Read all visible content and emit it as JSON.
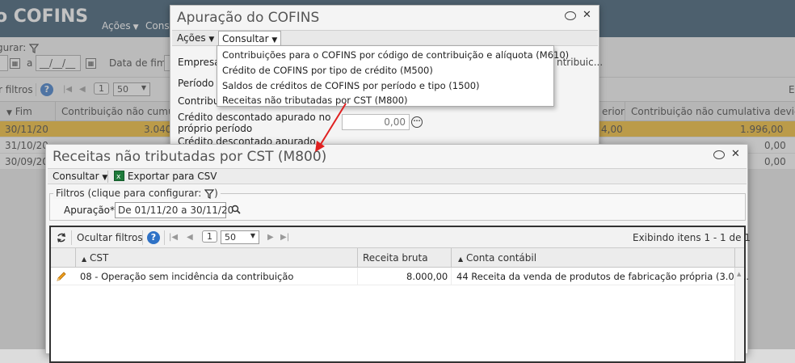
{
  "background": {
    "app_title": "o COFINS",
    "menu": {
      "acoes": "Ações",
      "cons": "Cons"
    },
    "filter_label": "gurar:",
    "date_placeholder": "__/__/__",
    "date_sep": "a",
    "date_end_label": "Data de fim",
    "toolbar_filters": "r filtros",
    "page_num": "1",
    "page_size": "50",
    "right_edge_text": "E",
    "grid_headers": {
      "fim": "Fim",
      "contrib_nao_cumul": "Contribuição não cumulativ",
      "erior": "erior",
      "contrib_devida": "Contribuição não cumulativa devida"
    },
    "rows": [
      {
        "fim": "30/11/20",
        "valor": "3.040",
        "anterior": "4,00",
        "devida": "1.996,00"
      },
      {
        "fim": "31/10/20",
        "valor": "",
        "anterior": "",
        "devida": "0,00"
      },
      {
        "fim": "30/09/20",
        "valor": "",
        "anterior": "",
        "devida": "0,00"
      }
    ]
  },
  "dialog1": {
    "title": "Apuração do COFINS",
    "menu": {
      "acoes": "Ações",
      "consultar": "Consultar"
    },
    "dropdown": [
      "Contribuições para o COFINS por código de contribuição e alíquota (M610)",
      "Crédito de COFINS por tipo de crédito (M500)",
      "Saldos de créditos de COFINS por período e tipo (1500)",
      "Receitas não tributadas por CST (M800)"
    ],
    "labels": {
      "empresa": "Empresa",
      "periodo": "Período d",
      "contribui": "Contribui",
      "credito_proprio_1": "Crédito descontado apurado no",
      "credito_proprio_2": "próprio período",
      "credito_apurado": "Crédito descontado apurado",
      "tribuic": "ntribuic..."
    },
    "credito_value": "0,00"
  },
  "dialog2": {
    "title": "Receitas não tributadas por CST (M800)",
    "menu": {
      "consultar": "Consultar",
      "exportar": "Exportar para CSV"
    },
    "filters_legend": "Filtros (clique para configurar:",
    "apuracao_label": "Apuração*",
    "apuracao_value": "De 01/11/20 a 30/11/20",
    "grid": {
      "hide_filters": "Ocultar filtros",
      "page_num": "1",
      "page_size": "50",
      "showing": "Exibindo itens 1 - 1 de 1",
      "headers": {
        "cst": "CST",
        "receita": "Receita bruta",
        "conta": "Conta contábil"
      },
      "rows": [
        {
          "cst": "08 - Operação sem incidência da contribuição",
          "receita": "8.000,00",
          "conta": "44 Receita da venda de produtos de fabricação própria (3.01..."
        }
      ]
    }
  },
  "colors": {
    "header": "#2b4d67",
    "selected_row": "#f3b923",
    "arrow": "#e02020",
    "help": "#2f72c6"
  }
}
